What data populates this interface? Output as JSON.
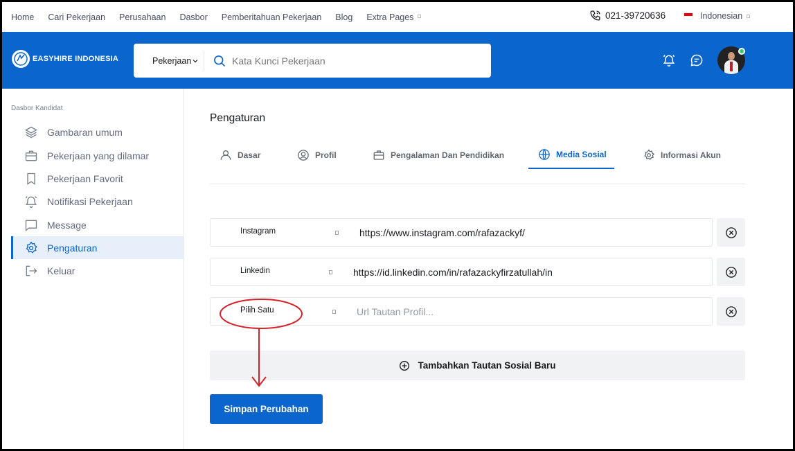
{
  "topnav": {
    "links": [
      "Home",
      "Cari Pekerjaan",
      "Perusahaan",
      "Dasbor",
      "Pemberitahuan Pekerjaan",
      "Blog",
      "Extra Pages"
    ],
    "phone": "021-39720636",
    "language": "Indonesian"
  },
  "header": {
    "brand": "EASYHIRE INDONESIA",
    "search_category": "Pekerjaan",
    "search_placeholder": "Kata Kunci Pekerjaan"
  },
  "sidebar": {
    "caption": "Dasbor Kandidat",
    "items": [
      {
        "label": "Gambaran umum",
        "icon": "layers-icon"
      },
      {
        "label": "Pekerjaan yang dilamar",
        "icon": "briefcase-icon"
      },
      {
        "label": "Pekerjaan Favorit",
        "icon": "bookmark-icon"
      },
      {
        "label": "Notifikasi Pekerjaan",
        "icon": "bell-icon"
      },
      {
        "label": "Message",
        "icon": "message-icon"
      },
      {
        "label": "Pengaturan",
        "icon": "gear-icon",
        "active": true
      },
      {
        "label": "Keluar",
        "icon": "logout-icon"
      }
    ]
  },
  "main": {
    "title": "Pengaturan",
    "tabs": [
      {
        "label": "Dasar",
        "icon": "user-icon"
      },
      {
        "label": "Profil",
        "icon": "user-circle-icon"
      },
      {
        "label": "Pengalaman Dan Pendidikan",
        "icon": "briefcase-icon"
      },
      {
        "label": "Media Sosial",
        "icon": "globe-icon",
        "active": true
      },
      {
        "label": "Informasi Akun",
        "icon": "gear-icon"
      }
    ],
    "social_links": [
      {
        "platform": "Instagram",
        "url": "https://www.instagram.com/rafazackyf/",
        "placeholder": ""
      },
      {
        "platform": "Linkedin",
        "url": "https://id.linkedin.com/in/rafazackyfirzatullah/in",
        "placeholder": ""
      },
      {
        "platform": "Pilih Satu",
        "url": "",
        "placeholder": "Url Tautan Profil..."
      }
    ],
    "add_link_label": "Tambahkan Tautan Sosial Baru",
    "save_label": "Simpan Perubahan"
  },
  "colors": {
    "primary": "#0a65cc",
    "annotation": "#d62128",
    "online": "#2dcc70"
  }
}
